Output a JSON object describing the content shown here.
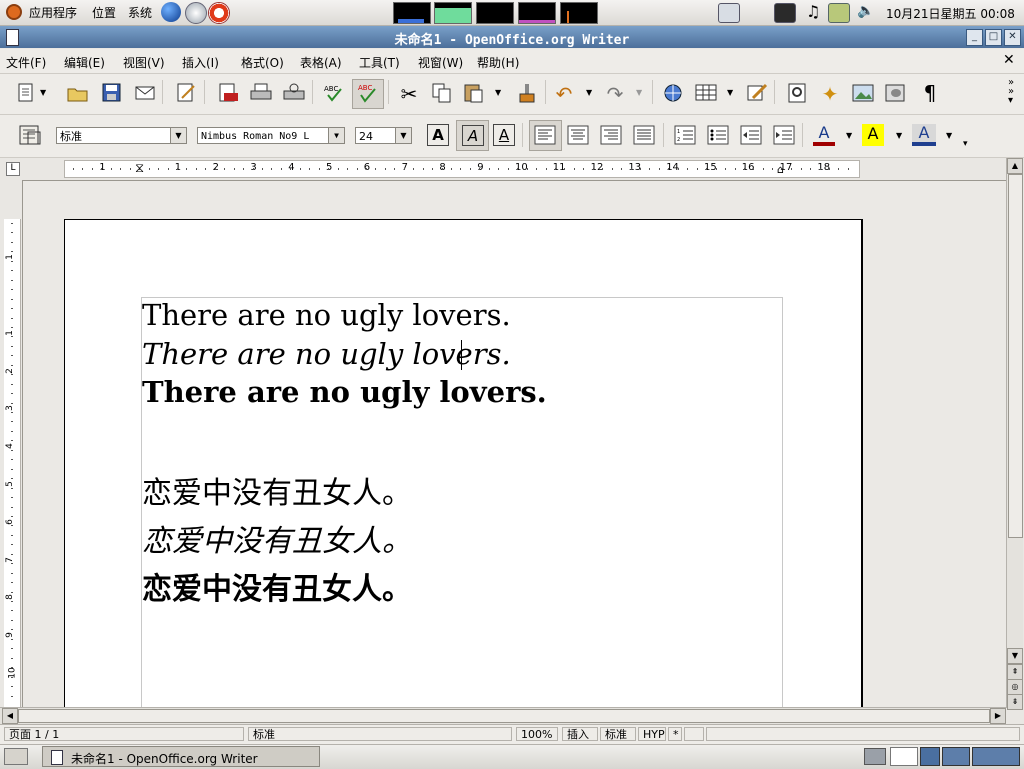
{
  "top_panel": {
    "menus": [
      "应用程序",
      "位置",
      "系统"
    ],
    "clock": "10月21日星期五 00:08"
  },
  "window": {
    "title": "未命名1 - OpenOffice.org Writer"
  },
  "menubar": {
    "items": [
      "文件(F)",
      "编辑(E)",
      "视图(V)",
      "插入(I)",
      "格式(O)",
      "表格(A)",
      "工具(T)",
      "视窗(W)",
      "帮助(H)"
    ]
  },
  "format_toolbar": {
    "paragraph_style": "标准",
    "font_name": "Nimbus Roman No9 L",
    "font_size": "24",
    "font_color": "#a00000",
    "highlight_color": "#ffff00",
    "background_color": "#1f3f8f"
  },
  "ruler": {
    "h_numbers": [
      "1",
      "1",
      "2",
      "3",
      "4",
      "5",
      "6",
      "7",
      "8",
      "9",
      "10",
      "11",
      "12",
      "13",
      "14",
      "15",
      "16",
      "17",
      "18"
    ],
    "v_numbers": [
      "1",
      "1",
      "2",
      "3",
      "4",
      "5",
      "6",
      "7",
      "8",
      "9",
      "10"
    ]
  },
  "document": {
    "lines": [
      "There are no ugly lovers.",
      "There are no ugly lovers.",
      "There are no ugly lovers.",
      "恋爱中没有丑女人。",
      "恋爱中没有丑女人。",
      "恋爱中没有丑女人。"
    ]
  },
  "statusbar": {
    "page": "页面 1 / 1",
    "style": "标准",
    "zoom": "100%",
    "insert_mode": "插入",
    "selection_mode": "标准",
    "hyphenation": "HYP",
    "modified": "*"
  },
  "taskbar": {
    "active_window": "未命名1 - OpenOffice.org Writer"
  }
}
